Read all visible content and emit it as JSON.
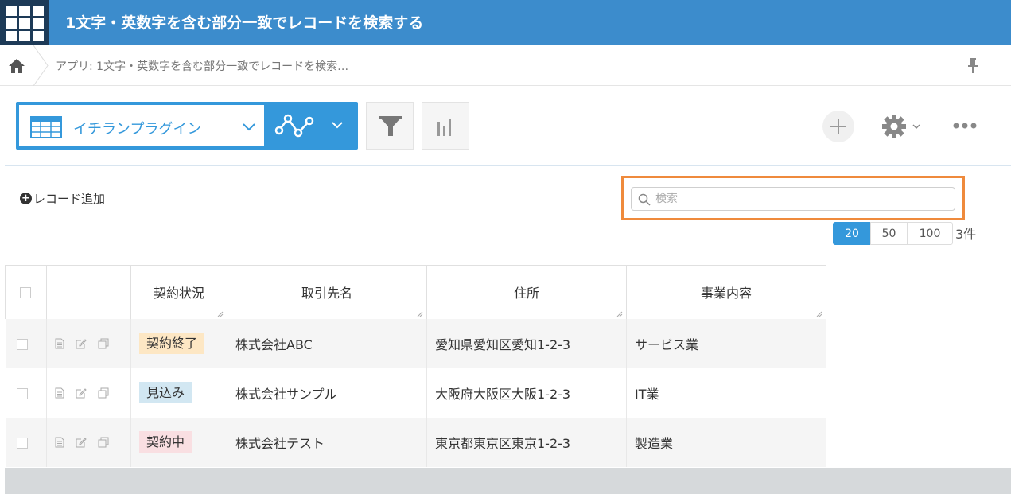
{
  "header": {
    "title": "1文字・英数字を含む部分一致でレコードを検索する"
  },
  "breadcrumb": {
    "text": "アプリ: 1文字・英数字を含む部分一致でレコードを検索…"
  },
  "toolbar": {
    "view_name": "イチランプラグイン"
  },
  "actions": {
    "add_record": "レコード追加"
  },
  "search": {
    "placeholder": "検索",
    "value": ""
  },
  "pagination": {
    "options": [
      "20",
      "50",
      "100"
    ],
    "selected": "20",
    "count": "3件"
  },
  "table": {
    "columns": [
      "契約状況",
      "取引先名",
      "住所",
      "事業内容"
    ],
    "rows": [
      {
        "status": "契約終了",
        "company": "株式会社ABC",
        "address": "愛知県愛知区愛知1-2-3",
        "business": "サービス業"
      },
      {
        "status": "見込み",
        "company": "株式会社サンプル",
        "address": "大阪府大阪区大阪1-2-3",
        "business": "IT業"
      },
      {
        "status": "契約中",
        "company": "株式会社テスト",
        "address": "東京都東京区東京1-2-3",
        "business": "製造業"
      }
    ]
  },
  "colors": {
    "header_bg": "#3c8ccc",
    "app_icon_bg": "#1d3a57",
    "accent": "#3498db",
    "search_highlight": "#ef8a3c",
    "badge_end": "#fde7c4",
    "badge_prospect": "#d2e7f2",
    "badge_active": "#f9dfe2"
  }
}
